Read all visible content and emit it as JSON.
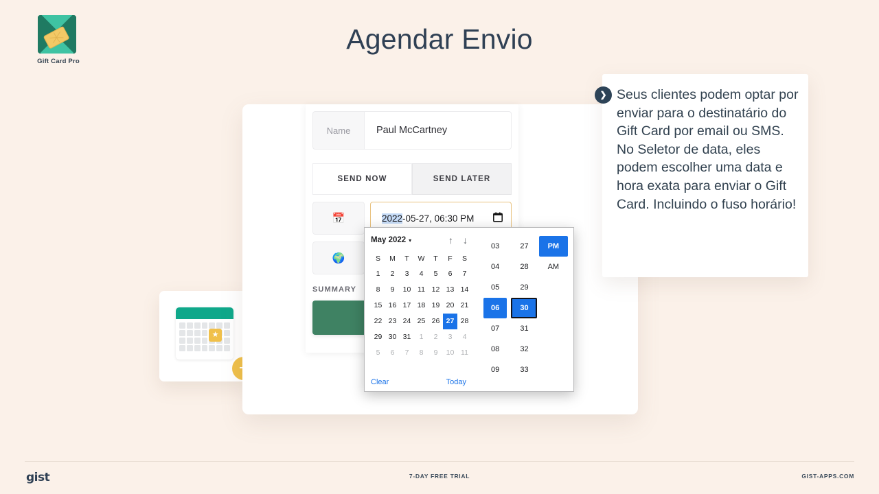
{
  "brand": {
    "logo_label": "Gift Card Pro",
    "logo_icon": "gift-card-diamond-logo",
    "colors": {
      "teal": "#1f7a62",
      "mint": "#3fc3a3",
      "gold": "#f0c04a",
      "accent_blue": "#1a73e8",
      "background": "#fbf1e9",
      "title": "#2f4054"
    }
  },
  "header": {
    "title": "Agendar Envio"
  },
  "illustration": {
    "icon": "calendar-star-icon",
    "badge_icon": "plus-badge-icon",
    "badge_glyph": "+",
    "star_glyph": "★"
  },
  "form": {
    "name_label": "Name",
    "name_value": "Paul McCartney",
    "tabs": [
      {
        "label": "SEND NOW",
        "active": false
      },
      {
        "label": "SEND LATER",
        "active": true
      }
    ],
    "datetime": {
      "icon": "📅",
      "selected_part": "2022",
      "rest": "-05-27, 06:30 PM",
      "calendar_glyph": "🗓",
      "full_value": "2022-05-27, 06:30 PM"
    },
    "timezone": {
      "icon": "🌍"
    },
    "summary_label": "SUMMARY"
  },
  "picker": {
    "month_label": "May 2022",
    "caret_glyph": "▾",
    "nav_up": "↑",
    "nav_down": "↓",
    "dow": [
      "S",
      "M",
      "T",
      "W",
      "T",
      "F",
      "S"
    ],
    "weeks": [
      [
        {
          "d": "1",
          "m": false
        },
        {
          "d": "2",
          "m": false
        },
        {
          "d": "3",
          "m": false
        },
        {
          "d": "4",
          "m": false
        },
        {
          "d": "5",
          "m": false
        },
        {
          "d": "6",
          "m": false
        },
        {
          "d": "7",
          "m": false
        }
      ],
      [
        {
          "d": "8",
          "m": false
        },
        {
          "d": "9",
          "m": false
        },
        {
          "d": "10",
          "m": false
        },
        {
          "d": "11",
          "m": false
        },
        {
          "d": "12",
          "m": false
        },
        {
          "d": "13",
          "m": false
        },
        {
          "d": "14",
          "m": false
        }
      ],
      [
        {
          "d": "15",
          "m": false
        },
        {
          "d": "16",
          "m": false
        },
        {
          "d": "17",
          "m": false
        },
        {
          "d": "18",
          "m": false
        },
        {
          "d": "19",
          "m": false
        },
        {
          "d": "20",
          "m": false
        },
        {
          "d": "21",
          "m": false
        }
      ],
      [
        {
          "d": "22",
          "m": false
        },
        {
          "d": "23",
          "m": false
        },
        {
          "d": "24",
          "m": false
        },
        {
          "d": "25",
          "m": false
        },
        {
          "d": "26",
          "m": false
        },
        {
          "d": "27",
          "m": false,
          "sel": true
        },
        {
          "d": "28",
          "m": false
        }
      ],
      [
        {
          "d": "29",
          "m": false
        },
        {
          "d": "30",
          "m": false
        },
        {
          "d": "31",
          "m": false
        },
        {
          "d": "1",
          "m": true
        },
        {
          "d": "2",
          "m": true
        },
        {
          "d": "3",
          "m": true
        },
        {
          "d": "4",
          "m": true
        }
      ],
      [
        {
          "d": "5",
          "m": true
        },
        {
          "d": "6",
          "m": true
        },
        {
          "d": "7",
          "m": true
        },
        {
          "d": "8",
          "m": true
        },
        {
          "d": "9",
          "m": true
        },
        {
          "d": "10",
          "m": true
        },
        {
          "d": "11",
          "m": true
        }
      ]
    ],
    "clear_label": "Clear",
    "today_label": "Today",
    "hours": [
      "03",
      "04",
      "05",
      "06",
      "07",
      "08",
      "09"
    ],
    "hour_selected": "06",
    "minutes": [
      "27",
      "28",
      "29",
      "30",
      "31",
      "32",
      "33"
    ],
    "minute_selected": "30",
    "meridiem": [
      "PM",
      "AM"
    ],
    "meridiem_selected": "PM"
  },
  "callout": {
    "arrow_glyph": "❯",
    "text": "Seus clientes podem optar por enviar para o destinatário do Gift Card por email ou SMS. No Seletor de data, eles podem escolher uma data e hora exata para enviar o Gift Card. Incluindo o fuso horário!"
  },
  "footer": {
    "left": "gist",
    "center": "7-DAY FREE TRIAL",
    "right": "GIST-APPS.COM"
  }
}
